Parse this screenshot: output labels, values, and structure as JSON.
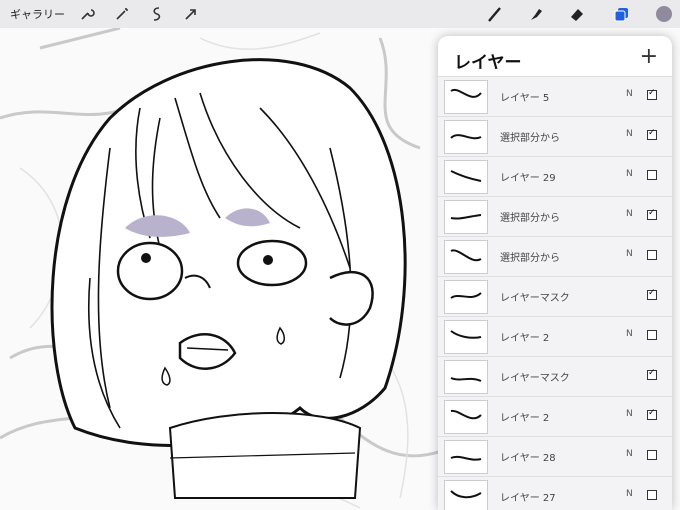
{
  "app": {
    "gallery_label": "ギャラリー"
  },
  "colors": {
    "accent_blue": "#1f5fe0",
    "current_color": "#8f8a9e"
  },
  "toolbar": {
    "left_icons": [
      "wrench-icon",
      "magic-wand-icon",
      "selection-icon",
      "transform-arrow-icon"
    ],
    "right_icons": [
      "brush-icon",
      "smudge-icon",
      "eraser-icon",
      "layers-icon",
      "color-swatch"
    ]
  },
  "layers_panel": {
    "title": "レイヤー",
    "add_label": "+",
    "layers": [
      {
        "name": "レイヤー 5",
        "blend": "N",
        "visible": true
      },
      {
        "name": "選択部分から",
        "blend": "N",
        "visible": true
      },
      {
        "name": "レイヤー 29",
        "blend": "N",
        "visible": false
      },
      {
        "name": "選択部分から",
        "blend": "N",
        "visible": true
      },
      {
        "name": "選択部分から",
        "blend": "N",
        "visible": false
      },
      {
        "name": "レイヤーマスク",
        "blend": "",
        "visible": true
      },
      {
        "name": "レイヤー 2",
        "blend": "N",
        "visible": false
      },
      {
        "name": "レイヤーマスク",
        "blend": "",
        "visible": true
      },
      {
        "name": "レイヤー 2",
        "blend": "N",
        "visible": true
      },
      {
        "name": "レイヤー 28",
        "blend": "N",
        "visible": false
      },
      {
        "name": "レイヤー 27",
        "blend": "N",
        "visible": false
      }
    ]
  }
}
